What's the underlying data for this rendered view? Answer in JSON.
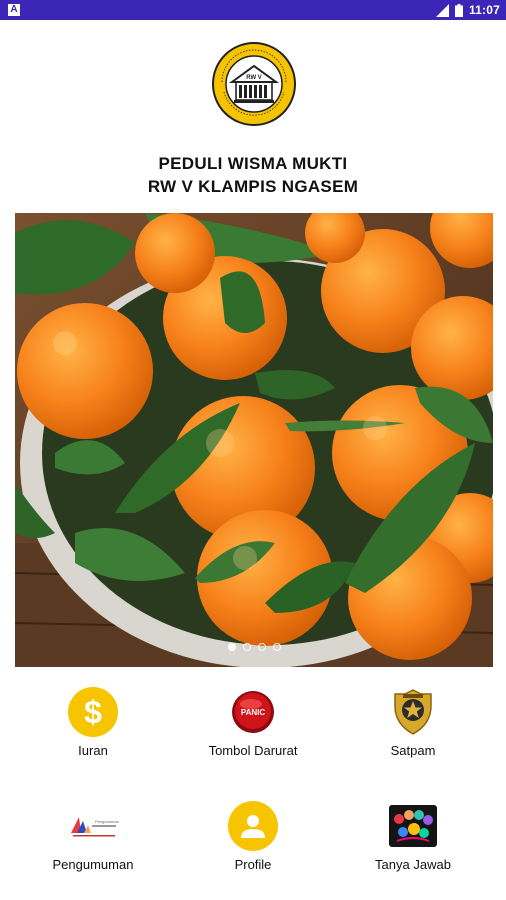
{
  "status_bar": {
    "time": "11:07",
    "notification_icon": "android-notification-icon",
    "background": "#3b26b8"
  },
  "header": {
    "logo_icon": "rw-v-wisma-mukti-seal",
    "title_line1": "PEDULI WISMA MUKTI",
    "title_line2": "RW V KLAMPIS NGASEM"
  },
  "banner": {
    "image": "basket-of-tangerines-photo",
    "slides_total": 4,
    "active_slide": 1
  },
  "menu": [
    {
      "label": "Iuran",
      "icon": "dollar-icon"
    },
    {
      "label": "Tombol Darurat",
      "icon": "panic-button-icon"
    },
    {
      "label": "Satpam",
      "icon": "security-badge-icon"
    },
    {
      "label": "Pengumuman",
      "icon": "announcement-logo-icon"
    },
    {
      "label": "Profile",
      "icon": "user-profile-icon"
    },
    {
      "label": "Tanya Jawab",
      "icon": "question-answer-icon"
    }
  ],
  "colors": {
    "accent_yellow": "#f7c500",
    "panic_red": "#d0141a",
    "badge_gold": "#d8a82a"
  }
}
